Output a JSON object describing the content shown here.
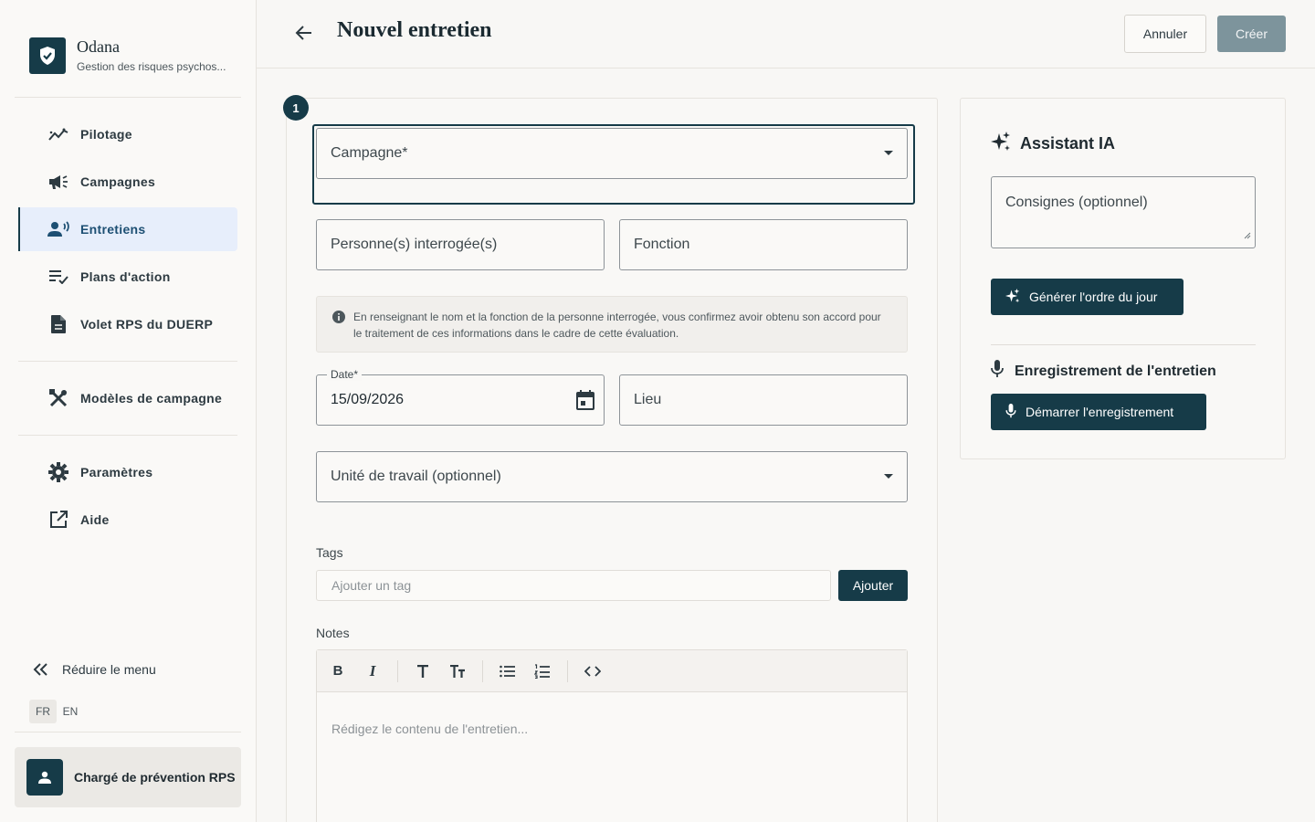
{
  "brand": {
    "name": "Odana",
    "subtitle": "Gestion des risques psychos..."
  },
  "sidebar": {
    "items": [
      {
        "label": "Pilotage",
        "icon": "chart-line-icon"
      },
      {
        "label": "Campagnes",
        "icon": "megaphone-icon"
      },
      {
        "label": "Entretiens",
        "icon": "interview-icon",
        "active": true
      },
      {
        "label": "Plans d'action",
        "icon": "checklist-icon"
      },
      {
        "label": "Volet RPS du DUERP",
        "icon": "document-icon"
      },
      {
        "label": "Modèles de campagne",
        "icon": "tools-icon"
      },
      {
        "label": "Paramètres",
        "icon": "gear-icon"
      },
      {
        "label": "Aide",
        "icon": "external-link-icon"
      }
    ],
    "reduce_label": "Réduire le menu",
    "languages": [
      "FR",
      "EN"
    ],
    "active_language": "FR",
    "user_role": "Chargé de prévention RPS"
  },
  "header": {
    "title": "Nouvel entretien",
    "cancel_label": "Annuler",
    "create_label": "Créer"
  },
  "form": {
    "step_number": "1",
    "campaign_label": "Campagne*",
    "person_label": "Personne(s) interrogée(s)",
    "function_label": "Fonction",
    "info_text": "En renseignant le nom et la fonction de la personne interrogée, vous confirmez avoir obtenu son accord pour le traitement de ces informations dans le cadre de cette évaluation.",
    "date_label": "Date*",
    "date_value": "15/09/2026",
    "place_label": "Lieu",
    "unit_label": "Unité de travail (optionnel)",
    "tags_label": "Tags",
    "tag_placeholder": "Ajouter un tag",
    "add_label": "Ajouter",
    "notes_label": "Notes",
    "editor_placeholder": "Rédigez le contenu de l'entretien...",
    "toolbar": [
      "bold-icon",
      "italic-icon",
      "text-icon",
      "text-size-icon",
      "bullet-list-icon",
      "numbered-list-icon",
      "code-icon"
    ]
  },
  "assistant": {
    "title": "Assistant IA",
    "instructions_placeholder": "Consignes (optionnel)",
    "generate_label": "Générer l'ordre du jour",
    "recording_title": "Enregistrement de l'entretien",
    "start_recording_label": "Démarrer l'enregistrement"
  },
  "colors": {
    "primary": "#163b48",
    "active_bg": "#e7eefb",
    "create_disabled": "#7d949c"
  }
}
